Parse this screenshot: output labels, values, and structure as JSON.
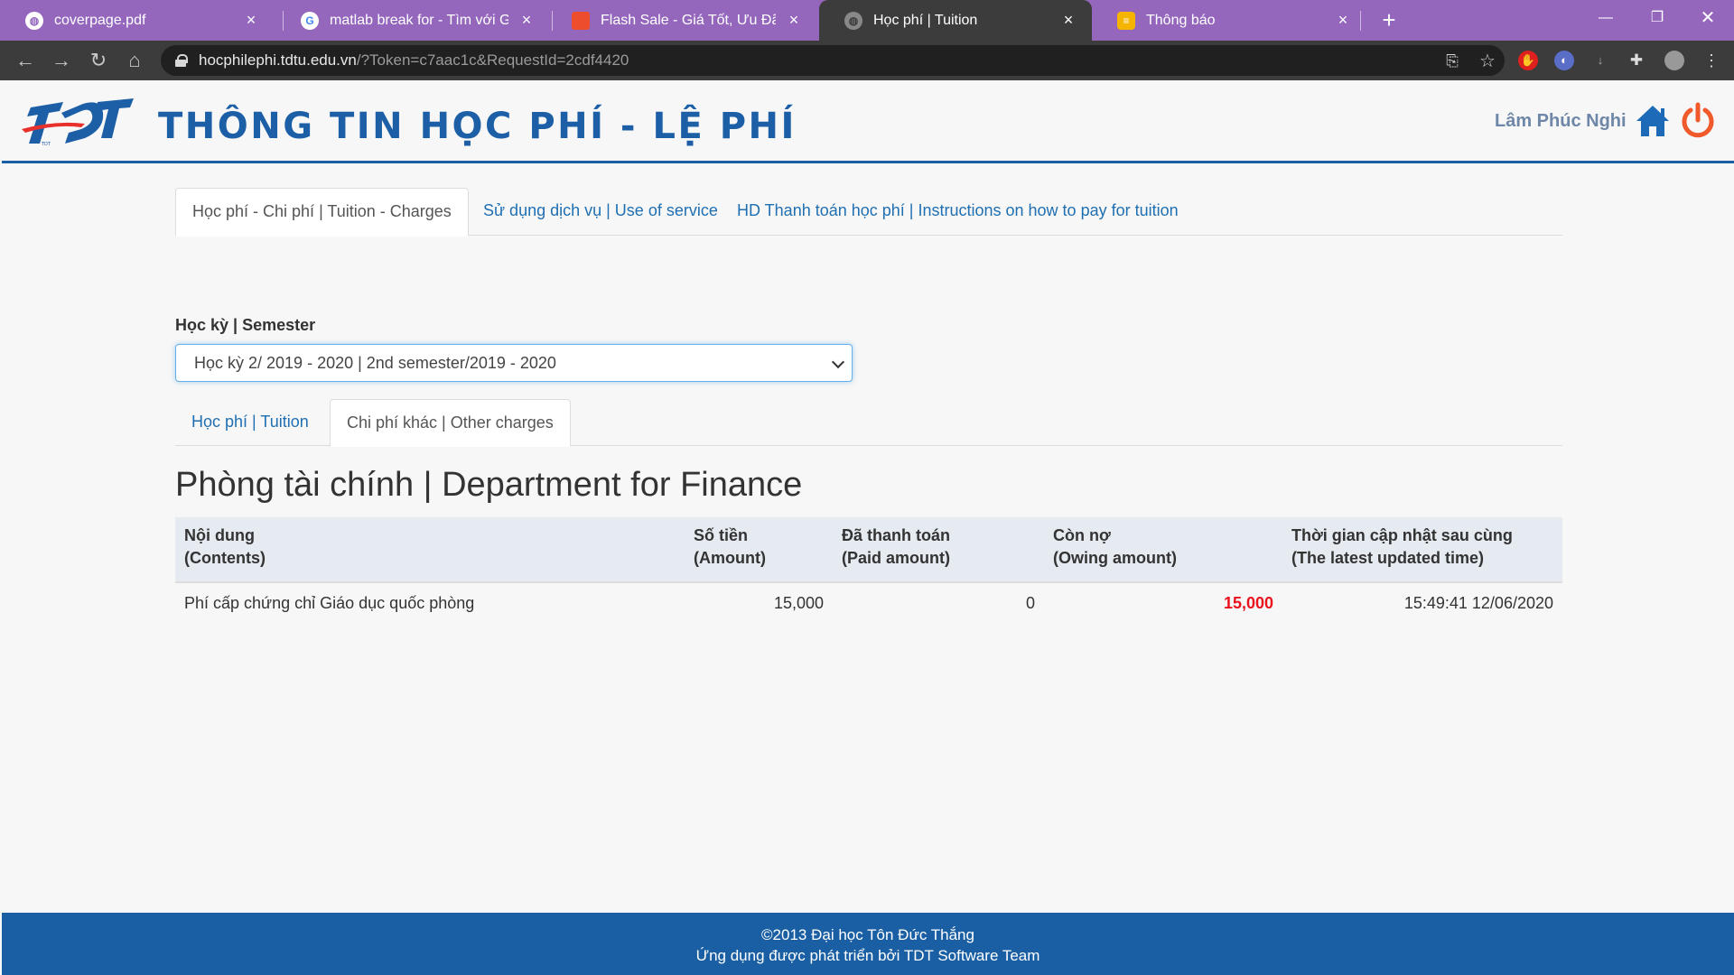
{
  "browser": {
    "tabs": [
      {
        "title": "coverpage.pdf",
        "icon": "globe-icon"
      },
      {
        "title": "matlab break for - Tìm với Google",
        "icon": "google-icon"
      },
      {
        "title": "Flash Sale - Giá Tốt, Ưu Đãi Khủng",
        "icon": "shopee-icon"
      },
      {
        "title": "Học phí | Tuition",
        "icon": "globe-icon",
        "active": true
      },
      {
        "title": "Thông báo",
        "icon": "notification-icon"
      }
    ],
    "close_glyph": "×",
    "new_tab_glyph": "+",
    "url_host": "hocphilephi.tdtu.edu.vn",
    "url_rest": "/?Token=c7aac1c&RequestId=2cdf4420"
  },
  "header": {
    "site_title": "THÔNG TIN HỌC PHÍ - LỆ PHÍ",
    "user_name": "Lâm Phúc Nghi",
    "logo_text": "TDT"
  },
  "main_tabs": [
    {
      "label": "Học phí - Chi phí | Tuition - Charges",
      "active": true
    },
    {
      "label": "Sử dụng dịch vụ | Use of service",
      "active": false
    },
    {
      "label": "HD Thanh toán học phí | Instructions on how to pay for tuition",
      "active": false
    }
  ],
  "semester": {
    "label": "Học kỳ | Semester",
    "selected": "Học kỳ 2/ 2019 - 2020 | 2nd semester/2019 - 2020"
  },
  "sub_tabs": [
    {
      "label": "Học phí | Tuition",
      "active": false
    },
    {
      "label": "Chi phí khác | Other charges",
      "active": true
    }
  ],
  "department_title": "Phòng tài chính | Department for Finance",
  "table": {
    "headers": [
      {
        "line1": "Nội dung",
        "line2": "(Contents)"
      },
      {
        "line1": "Số tiền",
        "line2": "(Amount)"
      },
      {
        "line1": "Đã thanh toán",
        "line2": "(Paid amount)"
      },
      {
        "line1": "Còn nợ",
        "line2": "(Owing amount)"
      },
      {
        "line1": "Thời gian cập nhật sau cùng",
        "line2": "(The latest updated time)"
      }
    ],
    "rows": [
      {
        "content": "Phí cấp chứng chỉ Giáo dục quốc phòng",
        "amount": "15,000",
        "paid": "0",
        "owing": "15,000",
        "updated": "15:49:41 12/06/2020"
      }
    ]
  },
  "footer": {
    "line1": "©2013 Đại học Tôn Đức Thắng",
    "line2": "Ứng dụng được phát triển bởi TDT Software Team"
  },
  "colors": {
    "brand_blue": "#1a5fa3",
    "owing_red": "#e8111c",
    "tab_strip": "#9467bd"
  }
}
